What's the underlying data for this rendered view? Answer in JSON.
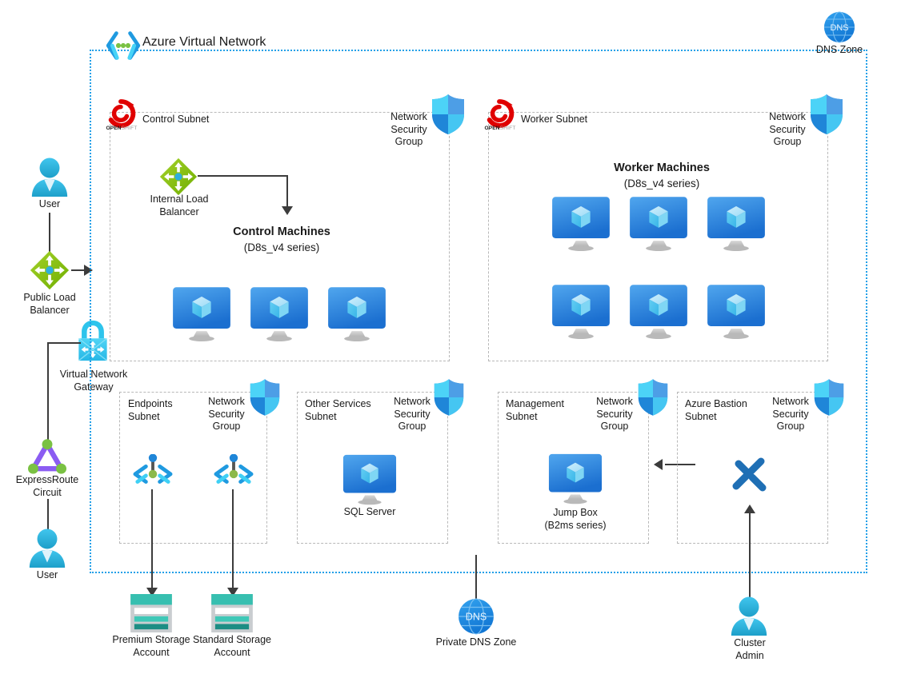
{
  "diagram": {
    "title": "Azure Virtual Network",
    "vnet_border_color": "#22a0e8",
    "subnet_border_color": "#b8b8b8",
    "connector_color": "#3c3c3c"
  },
  "top_right": {
    "dns_zone_label": "DNS Zone",
    "dns_glyph": "DNS"
  },
  "left_column": {
    "user_top_label": "User",
    "public_lb_label": "Public Load\nBalancer",
    "vnet_gateway_label": "Virtual Network\nGateway",
    "expressroute_label": "ExpressRoute\nCircuit",
    "user_bottom_label": "User"
  },
  "subnets": {
    "control": {
      "name": "Control Subnet",
      "nsg_label": "Network\nSecurity\nGroup",
      "openshift_text_bold": "OPEN",
      "openshift_text_light": "SHIFT",
      "ilb_label": "Internal Load\nBalancer",
      "machines_title": "Control Machines",
      "machines_series": "(D8s_v4 series)",
      "machine_count": 3
    },
    "worker": {
      "name": "Worker Subnet",
      "nsg_label": "Network\nSecurity\nGroup",
      "openshift_text_bold": "OPEN",
      "openshift_text_light": "SHIFT",
      "machines_title": "Worker Machines",
      "machines_series": "(D8s_v4 series)",
      "machine_count": 6
    },
    "endpoints": {
      "name": "Endpoints\nSubnet",
      "nsg_label": "Network\nSecurity\nGroup",
      "endpoint_count": 2
    },
    "other_services": {
      "name": "Other Services\nSubnet",
      "nsg_label": "Network\nSecurity\nGroup",
      "sql_label": "SQL Server"
    },
    "management": {
      "name": "Management\nSubnet",
      "nsg_label": "Network\nSecurity\nGroup",
      "jumpbox_label": "Jump Box",
      "jumpbox_series": "(B2ms series)"
    },
    "bastion": {
      "name": "Azure Bastion\nSubnet",
      "nsg_label": "Network\nSecurity\nGroup"
    }
  },
  "bottom_row": {
    "premium_storage_label": "Premium Storage\nAccount",
    "standard_storage_label": "Standard Storage\nAccount",
    "private_dns_label": "Private DNS Zone",
    "private_dns_glyph": "DNS",
    "cluster_admin_label": "Cluster\nAdmin"
  },
  "colors": {
    "azure_blue": "#0078d4",
    "vnet_dotted": "#22a0e8",
    "lb_green": "#7fba00",
    "openshift_red": "#e00000",
    "storage_teal": "#37bfb0",
    "bastion_blue": "#1f6fb5",
    "user_cyan": "#29b6e8"
  }
}
